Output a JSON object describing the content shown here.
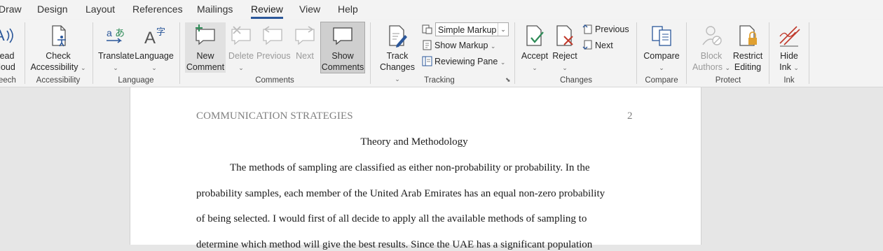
{
  "tabs": [
    {
      "label": "Draw"
    },
    {
      "label": "Design"
    },
    {
      "label": "Layout"
    },
    {
      "label": "References"
    },
    {
      "label": "Mailings"
    },
    {
      "label": "Review",
      "active": true
    },
    {
      "label": "View"
    },
    {
      "label": "Help"
    }
  ],
  "ribbon": {
    "speech": {
      "line1": "ead",
      "line2": "loud",
      "group": "eech"
    },
    "accessibility": {
      "line1": "Check",
      "line2": "Accessibility",
      "group": "Accessibility"
    },
    "language": {
      "translate": "Translate",
      "language": "Language",
      "group": "Language"
    },
    "comments": {
      "new_line1": "New",
      "new_line2": "Comment",
      "delete": "Delete",
      "previous": "Previous",
      "next": "Next",
      "show_line1": "Show",
      "show_line2": "Comments",
      "group": "Comments"
    },
    "tracking": {
      "track_line1": "Track",
      "track_line2": "Changes",
      "markup": "Simple Markup",
      "show_markup": "Show Markup",
      "reviewing_pane": "Reviewing Pane",
      "group": "Tracking"
    },
    "changes": {
      "accept": "Accept",
      "reject": "Reject",
      "previous": "Previous",
      "next": "Next",
      "group": "Changes"
    },
    "compare": {
      "label": "Compare",
      "group": "Compare"
    },
    "protect": {
      "block_line1": "Block",
      "block_line2": "Authors",
      "restrict_line1": "Restrict",
      "restrict_line2": "Editing",
      "group": "Protect"
    },
    "ink": {
      "line1": "Hide",
      "line2": "Ink",
      "group": "Ink"
    }
  },
  "document": {
    "running_head": "COMMUNICATION STRATEGIES",
    "page_number": "2",
    "title": "Theory and Methodology",
    "lines": [
      "The methods of sampling are classified as either non-probability or probability. In the",
      "probability samples, each member of the United Arab Emirates has an equal non-zero probability",
      "of being selected. I would first of all decide to apply all the available methods of sampling to",
      "determine which method will give the best results. Since the UAE has a significant population"
    ]
  },
  "colors": {
    "accent": "#2b579a",
    "green": "#2e8b57",
    "red": "#c0392b"
  }
}
